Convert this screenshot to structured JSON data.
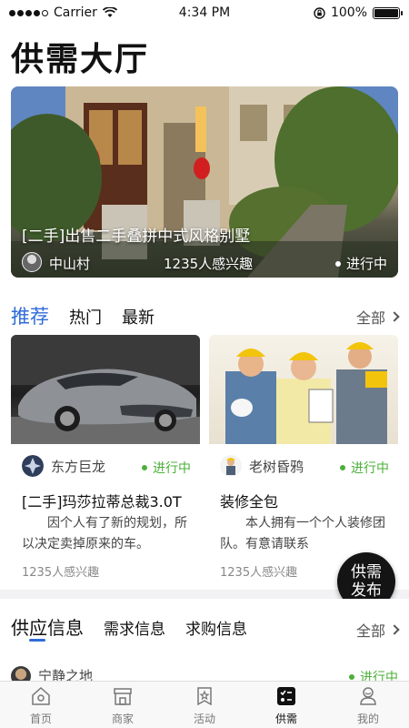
{
  "status_bar": {
    "carrier": "Carrier",
    "time": "4:34 PM",
    "battery": "100%",
    "battery_level": 1.0
  },
  "header": {
    "title": "供需大厅"
  },
  "hero": {
    "title": "[二手]出售二手叠拼中式风格别墅",
    "author": "中山村",
    "interest": "1235人感兴趣",
    "status": "进行中"
  },
  "recommend": {
    "tabs": [
      {
        "label": "推荐",
        "active": true
      },
      {
        "label": "热门",
        "active": false
      },
      {
        "label": "最新",
        "active": false
      }
    ],
    "see_all": "全部",
    "cards": [
      {
        "image": "sports-car-photo",
        "author": "东方巨龙",
        "status": "进行中",
        "title": "[二手]玛莎拉蒂总裁3.0T",
        "description": "因个人有了新的规划，所以决定卖掉原来的车。",
        "interest": "1235人感兴趣"
      },
      {
        "image": "construction-workers-photo",
        "author": "老树昏鸦",
        "status": "进行中",
        "title": "装修全包",
        "description": "本人拥有一个个人装修团队。有意请联系",
        "interest": "1235人感兴趣"
      }
    ]
  },
  "fab": {
    "line1": "供需",
    "line2": "发布"
  },
  "info": {
    "tabs": [
      {
        "label": "供应信息",
        "active": true
      },
      {
        "label": "需求信息",
        "active": false
      },
      {
        "label": "求购信息",
        "active": false
      }
    ],
    "see_all": "全部",
    "peek": {
      "author": "宁静之地",
      "status": "进行中"
    }
  },
  "tabbar": {
    "items": [
      {
        "label": "首页",
        "icon": "home-icon",
        "active": false
      },
      {
        "label": "商家",
        "icon": "shop-icon",
        "active": false
      },
      {
        "label": "活动",
        "icon": "activity-icon",
        "active": false
      },
      {
        "label": "供需",
        "icon": "supply-demand-icon",
        "active": true
      },
      {
        "label": "我的",
        "icon": "profile-icon",
        "active": false
      }
    ]
  },
  "colors": {
    "accent": "#2f6bd7",
    "status_green": "#4caf3a",
    "fab": "#141414"
  }
}
